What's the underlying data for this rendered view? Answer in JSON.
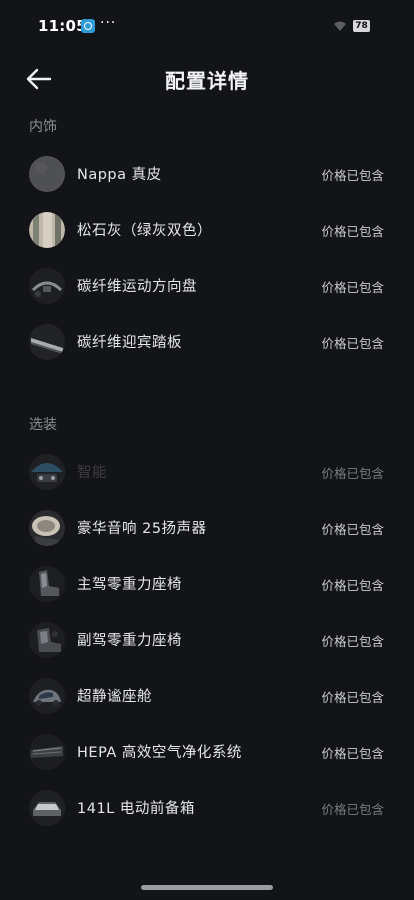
{
  "status_bar": {
    "time": "11:05",
    "more": "···",
    "battery": "78",
    "app_icon": "message-app-icon",
    "wifi_icon": "wifi-icon"
  },
  "header": {
    "title": "配置详情",
    "back_icon": "arrow-left-icon"
  },
  "sections": {
    "interior": {
      "label": "内饰",
      "items": [
        {
          "label": "Nappa 真皮",
          "price": "价格已包含",
          "icon": "leather-swatch-icon"
        },
        {
          "label": "松石灰（绿灰双色）",
          "price": "价格已包含",
          "icon": "color-swatch-icon"
        },
        {
          "label": "碳纤维运动方向盘",
          "price": "价格已包含",
          "icon": "steering-wheel-icon"
        },
        {
          "label": "碳纤维迎宾踏板",
          "price": "价格已包含",
          "icon": "door-sill-icon"
        }
      ]
    },
    "options": {
      "label": "选装",
      "items": [
        {
          "label": "智能",
          "price": "价格已包含",
          "icon": "smart-device-icon"
        },
        {
          "label": "豪华音响 25扬声器",
          "price": "价格已包含",
          "icon": "speaker-icon"
        },
        {
          "label": "主驾零重力座椅",
          "price": "价格已包含",
          "icon": "driver-seat-icon"
        },
        {
          "label": "副驾零重力座椅",
          "price": "价格已包含",
          "icon": "passenger-seat-icon"
        },
        {
          "label": "超静谧座舱",
          "price": "价格已包含",
          "icon": "quiet-cabin-icon"
        },
        {
          "label": "HEPA 高效空气净化系统",
          "price": "价格已包含",
          "icon": "air-filter-icon"
        },
        {
          "label": "141L 电动前备箱",
          "price": "价格已包含",
          "icon": "front-trunk-icon"
        }
      ]
    }
  },
  "colors": {
    "background": "#131417",
    "text_primary": "#e4e6ea",
    "text_secondary": "#8b8e95"
  }
}
